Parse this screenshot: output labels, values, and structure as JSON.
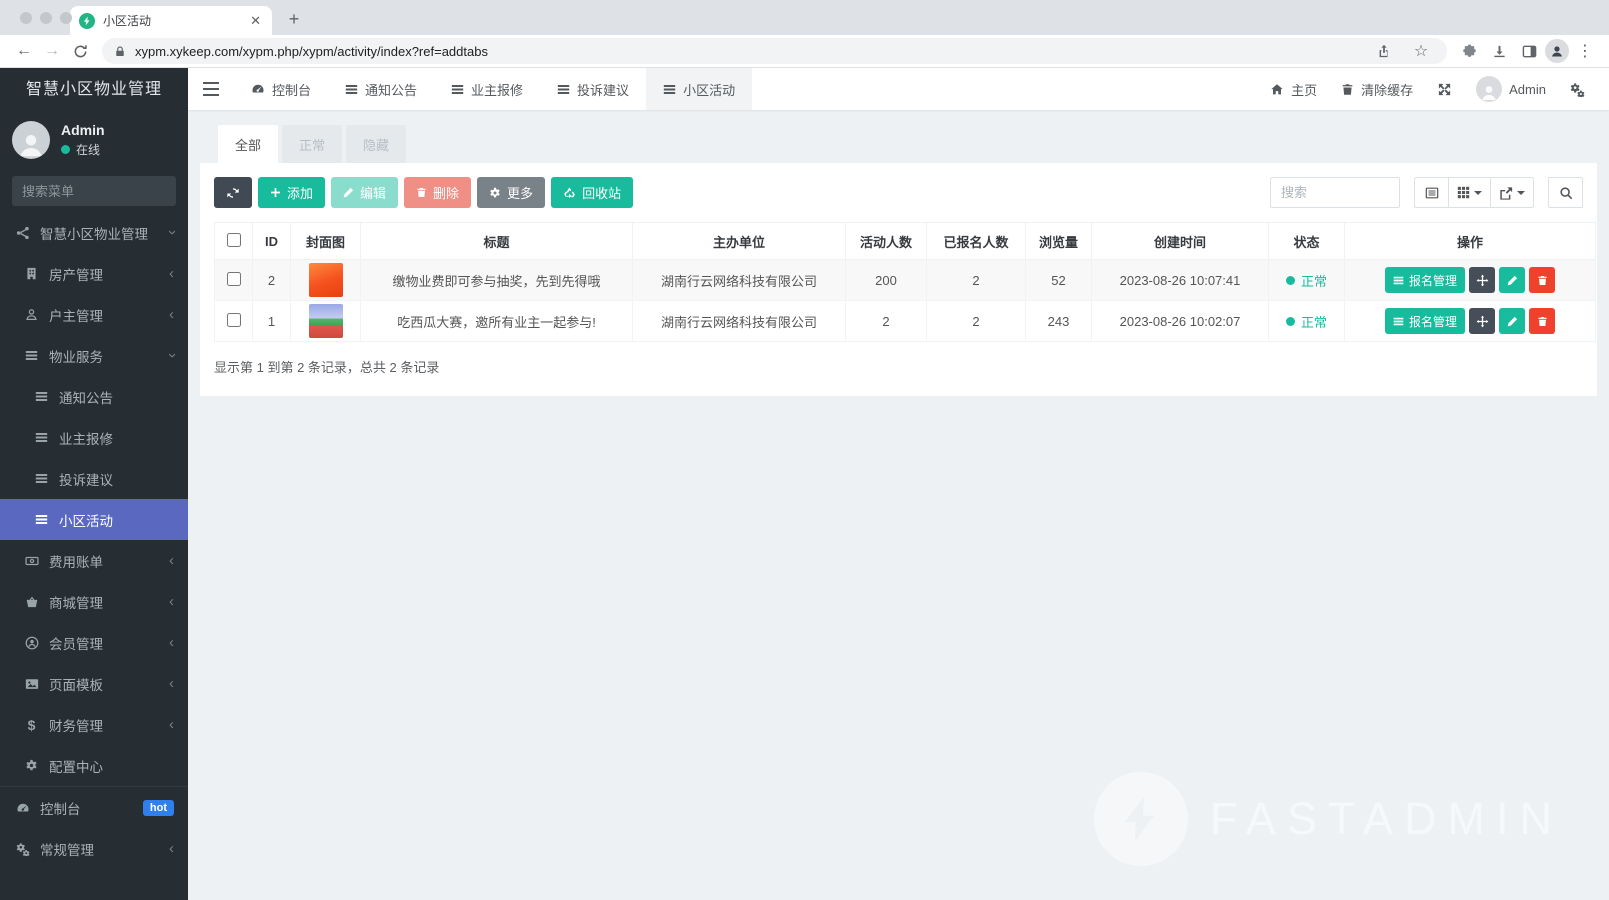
{
  "browser": {
    "tab_title": "小区活动",
    "url": "xypm.xykeep.com/xypm.php/xypm/activity/index?ref=addtabs"
  },
  "sidebar": {
    "title": "智慧小区物业管理",
    "user": {
      "name": "Admin",
      "status": "在线"
    },
    "search_placeholder": "搜索菜单",
    "menu": [
      {
        "label": "智慧小区物业管理",
        "icon": "share-nodes-icon",
        "state": "expanded"
      },
      {
        "label": "房产管理",
        "icon": "building-icon",
        "state": "collapsed"
      },
      {
        "label": "户主管理",
        "icon": "user-icon",
        "state": "collapsed"
      },
      {
        "label": "物业服务",
        "icon": "list-icon",
        "state": "expanded"
      },
      {
        "label": "通知公告",
        "icon": "list-icon"
      },
      {
        "label": "业主报修",
        "icon": "list-icon"
      },
      {
        "label": "投诉建议",
        "icon": "list-icon"
      },
      {
        "label": "小区活动",
        "icon": "list-icon",
        "active": true
      },
      {
        "label": "费用账单",
        "icon": "bill-icon",
        "state": "collapsed"
      },
      {
        "label": "商城管理",
        "icon": "basket-icon",
        "state": "collapsed"
      },
      {
        "label": "会员管理",
        "icon": "member-icon",
        "state": "collapsed"
      },
      {
        "label": "页面模板",
        "icon": "image-icon",
        "state": "collapsed"
      },
      {
        "label": "财务管理",
        "icon": "dollar-icon",
        "state": "collapsed"
      },
      {
        "label": "配置中心",
        "icon": "gear-icon"
      }
    ],
    "footer": [
      {
        "label": "控制台",
        "icon": "gauge-icon",
        "badge": "hot"
      },
      {
        "label": "常规管理",
        "icon": "gears-icon",
        "state": "collapsed"
      }
    ]
  },
  "topnav": {
    "tabs": [
      {
        "label": "控制台",
        "icon": "gauge-icon"
      },
      {
        "label": "通知公告",
        "icon": "list-icon"
      },
      {
        "label": "业主报修",
        "icon": "list-icon"
      },
      {
        "label": "投诉建议",
        "icon": "list-icon"
      },
      {
        "label": "小区活动",
        "icon": "list-icon",
        "active": true
      }
    ],
    "right": {
      "home": "主页",
      "clear_cache": "清除缓存",
      "user": "Admin"
    }
  },
  "panel": {
    "filter_tabs": [
      {
        "label": "全部",
        "active": true
      },
      {
        "label": "正常"
      },
      {
        "label": "隐藏"
      }
    ],
    "toolbar": {
      "add": "添加",
      "edit": "编辑",
      "delete": "删除",
      "more": "更多",
      "recycle": "回收站",
      "search_placeholder": "搜索"
    },
    "table": {
      "columns": [
        "ID",
        "封面图",
        "标题",
        "主办单位",
        "活动人数",
        "已报名人数",
        "浏览量",
        "创建时间",
        "状态",
        "操作"
      ],
      "rows": [
        {
          "id": "2",
          "title": "缴物业费即可参与抽奖，先到先得哦",
          "organizer": "湖南行云网络科技有限公司",
          "capacity": "200",
          "signed_up": "2",
          "views": "52",
          "created_at": "2023-08-26 10:07:41",
          "status": "正常",
          "signup_label": "报名管理"
        },
        {
          "id": "1",
          "title": "吃西瓜大赛，邀所有业主一起参与!",
          "organizer": "湖南行云网络科技有限公司",
          "capacity": "2",
          "signed_up": "2",
          "views": "243",
          "created_at": "2023-08-26 10:02:07",
          "status": "正常",
          "signup_label": "报名管理"
        }
      ],
      "summary": "显示第 1 到第 2 条记录，总共 2 条记录"
    }
  },
  "watermark": "FASTADMIN",
  "colors": {
    "accent_green": "#18bc9c",
    "active_menu_blue": "#5a68c0",
    "hot_badge_blue": "#2f80ed",
    "danger_red": "#e74c3c",
    "sidebar_bg": "#262d33"
  }
}
